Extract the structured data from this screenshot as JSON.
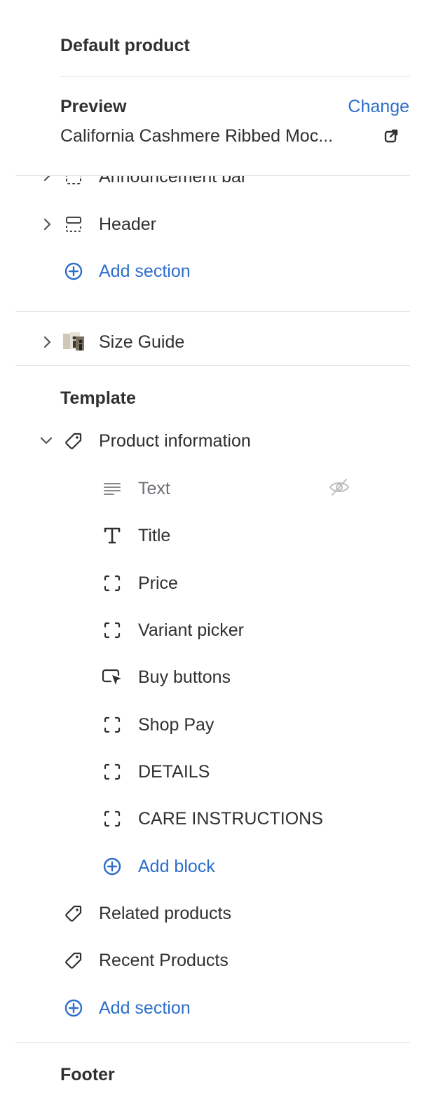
{
  "header": {
    "title": "Default product"
  },
  "preview": {
    "label": "Preview",
    "change_label": "Change",
    "product_name": "California Cashmere Ribbed Moc..."
  },
  "header_group": {
    "sections": [
      {
        "label": "Announcement bar"
      },
      {
        "label": "Header"
      }
    ],
    "add_section_label": "Add section"
  },
  "size_guide": {
    "label": "Size Guide"
  },
  "template": {
    "heading": "Template",
    "product_information": {
      "label": "Product information",
      "blocks": [
        {
          "label": "Text",
          "icon": "text-lines-icon",
          "hidden": true
        },
        {
          "label": "Title",
          "icon": "title-icon"
        },
        {
          "label": "Price",
          "icon": "block-icon"
        },
        {
          "label": "Variant picker",
          "icon": "block-icon"
        },
        {
          "label": "Buy buttons",
          "icon": "cursor-button-icon"
        },
        {
          "label": "Shop Pay",
          "icon": "block-icon"
        },
        {
          "label": "DETAILS",
          "icon": "block-icon"
        },
        {
          "label": "CARE INSTRUCTIONS",
          "icon": "block-icon"
        }
      ],
      "add_block_label": "Add block"
    },
    "sections": [
      {
        "label": "Related products"
      },
      {
        "label": "Recent Products"
      }
    ],
    "add_section_label": "Add section"
  },
  "footer": {
    "heading": "Footer"
  },
  "colors": {
    "accent": "#2c6ecb",
    "text": "#303030",
    "divider": "#e3e3e3"
  }
}
